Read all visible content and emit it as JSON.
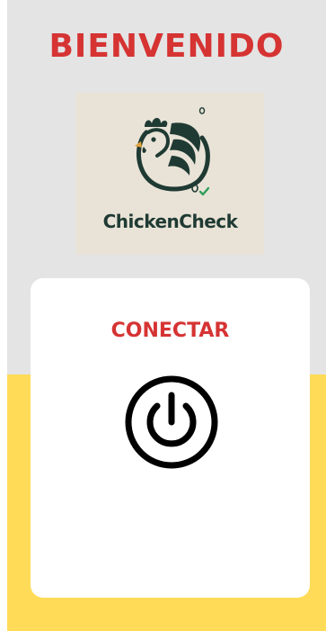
{
  "header": {
    "title": "BIENVENIDO"
  },
  "logo": {
    "brand_text": "ChickenCheck",
    "icon": "chicken-logo-icon"
  },
  "card": {
    "connect_label": "CONECTAR",
    "power_icon": "power-icon"
  },
  "colors": {
    "accent_red": "#d63333",
    "top_background": "#e4e4e4",
    "bottom_background": "#ffdb58",
    "card_background": "#ffffff",
    "logo_background": "#e9e3d7",
    "logo_ink": "#1f3a33",
    "logo_check": "#2e9e5b",
    "icon_dark": "#000000"
  }
}
